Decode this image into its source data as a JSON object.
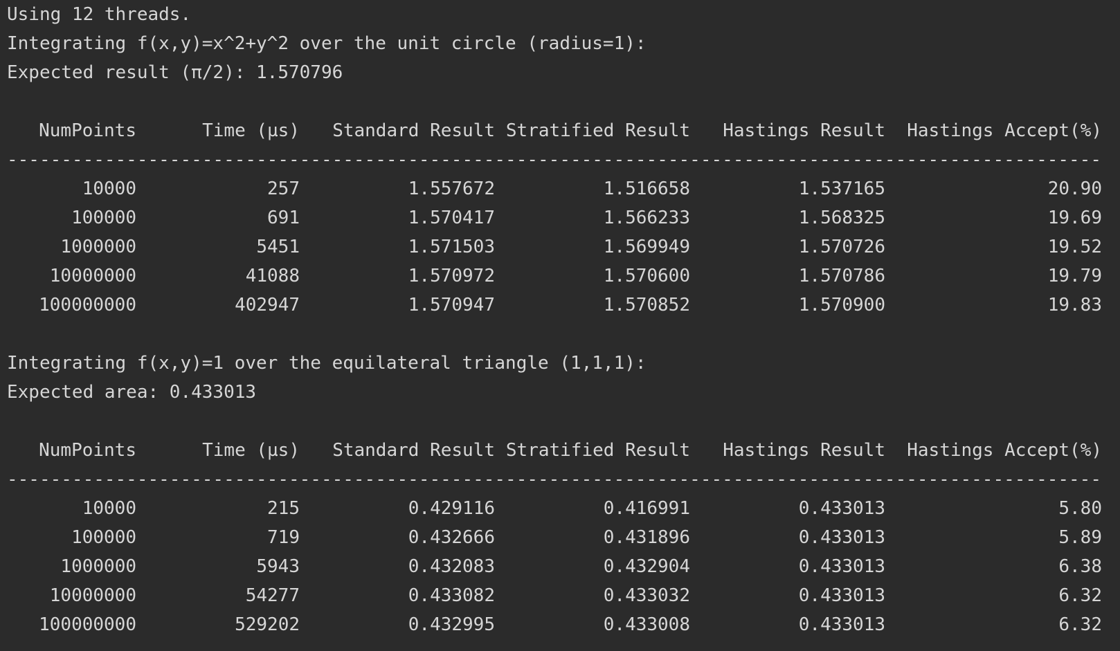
{
  "header": {
    "threads_line": "Using 12 threads."
  },
  "circle": {
    "title_line": "Integrating f(x,y)=x^2+y^2 over the unit circle (radius=1):",
    "expected_line": "Expected result (π/2): 1.570796",
    "columns": [
      "NumPoints",
      "Time (µs)",
      "Standard Result",
      "Stratified Result",
      "Hastings Result",
      "Hastings Accept(%)"
    ],
    "separator": "-----------------------------------------------------------------------------------------------------------------------",
    "rows": [
      [
        "10000",
        "257",
        "1.557672",
        "1.516658",
        "1.537165",
        "20.90"
      ],
      [
        "100000",
        "691",
        "1.570417",
        "1.566233",
        "1.568325",
        "19.69"
      ],
      [
        "1000000",
        "5451",
        "1.571503",
        "1.569949",
        "1.570726",
        "19.52"
      ],
      [
        "10000000",
        "41088",
        "1.570972",
        "1.570600",
        "1.570786",
        "19.79"
      ],
      [
        "100000000",
        "402947",
        "1.570947",
        "1.570852",
        "1.570900",
        "19.83"
      ]
    ]
  },
  "triangle": {
    "title_line": "Integrating f(x,y)=1 over the equilateral triangle (1,1,1):",
    "expected_line": "Expected area: 0.433013",
    "columns": [
      "NumPoints",
      "Time (µs)",
      "Standard Result",
      "Stratified Result",
      "Hastings Result",
      "Hastings Accept(%)"
    ],
    "separator": "-----------------------------------------------------------------------------------------------------------------------",
    "rows": [
      [
        "10000",
        "215",
        "0.429116",
        "0.416991",
        "0.433013",
        "5.80"
      ],
      [
        "100000",
        "719",
        "0.432666",
        "0.431896",
        "0.433013",
        "5.89"
      ],
      [
        "1000000",
        "5943",
        "0.432083",
        "0.432904",
        "0.433013",
        "6.38"
      ],
      [
        "10000000",
        "54277",
        "0.433082",
        "0.433032",
        "0.433013",
        "6.32"
      ],
      [
        "100000000",
        "529202",
        "0.432995",
        "0.433008",
        "0.433013",
        "6.32"
      ]
    ]
  }
}
